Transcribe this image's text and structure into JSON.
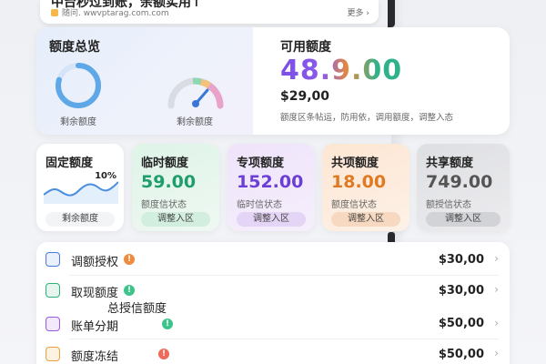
{
  "notice": {
    "title": "中台秒过到账，余额实用↑",
    "source": "随问. wwvptarag.com.com",
    "more": "更多 ›"
  },
  "overview": {
    "title": "额度总览",
    "ring_label": "剩余额度",
    "gauge_label": "剩余额度",
    "available_title": "可用额度",
    "available_amount": "48.9.00",
    "sub_amount": "$29,00",
    "description": "额度区条帖运，防用依，调用额度，调整入态"
  },
  "tiles": [
    {
      "title": "固定额度",
      "percent": "10%",
      "button": "剩余额度"
    },
    {
      "title": "临时额度",
      "value": "59.00",
      "status": "额度信状态",
      "button": "调整入区",
      "color": "#1e9e6a"
    },
    {
      "title": "专项额度",
      "value": "152.00",
      "status": "临时信状态",
      "button": "调整入区",
      "color": "#6b3fd6"
    },
    {
      "title": "共项额度",
      "value": "18.00",
      "status": "额度信状态",
      "button": "调整入区",
      "color": "#e07a22"
    },
    {
      "title": "共享额度",
      "value": "749.00",
      "status": "额授信状态",
      "button": "调整入区",
      "color": "#555555"
    }
  ],
  "list": {
    "rows": [
      {
        "label": "调额授权",
        "value": "$30,00",
        "icon_color": "#4a7be0",
        "badge_color": "#f08a3c",
        "badge": "!"
      },
      {
        "label": "取现额度",
        "value": "$30,00",
        "icon_color": "#2fb27a",
        "badge_color": "#3cc48a",
        "badge": "!"
      },
      {
        "label": "账单分期",
        "value": "$50,00",
        "icon_color": "#9a5be0",
        "badge_color": "#3cc48a",
        "badge": "!"
      },
      {
        "label": "额度冻结",
        "value": "$50,00",
        "icon_color": "#e7a23c",
        "badge_color": "#f06a5a",
        "badge": "!"
      }
    ],
    "extra_label": "总授信额度"
  },
  "icons": {
    "row_icons": [
      "clipboard-icon",
      "wallet-icon",
      "document-icon",
      "lock-document-icon"
    ],
    "chevron": "chevron-right-icon"
  }
}
